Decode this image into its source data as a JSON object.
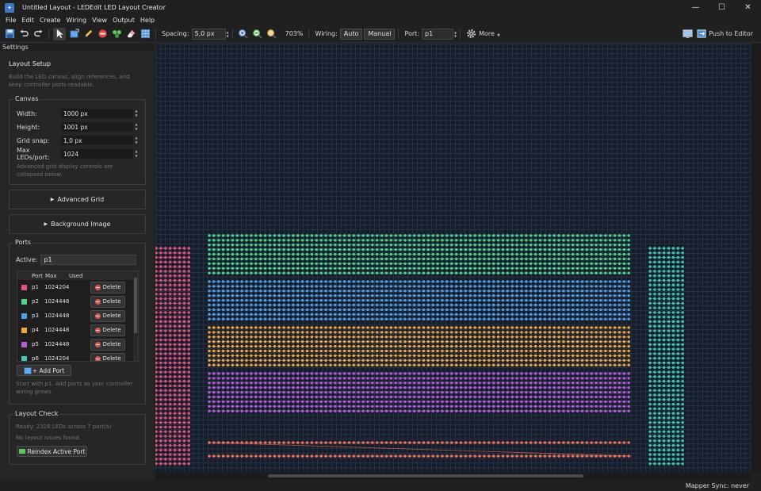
{
  "window": {
    "title": "Untitled Layout - LEDEdit LED Layout Creator"
  },
  "menu": [
    "File",
    "Edit",
    "Create",
    "Wiring",
    "View",
    "Output",
    "Help"
  ],
  "toolbar": {
    "spacing_label": "Spacing:",
    "spacing_value": "5,0 px",
    "zoom": "703%",
    "wiring_label": "Wiring:",
    "wiring_auto": "Auto",
    "wiring_manual": "Manual",
    "port_label": "Port:",
    "port_value": "p1",
    "more_label": "More",
    "push_label": "Push to Editor"
  },
  "settings_label": "Settings",
  "layout_setup": {
    "title": "Layout Setup",
    "description": "Build the LED canvas, align references, and keep controller ports readable."
  },
  "canvas_group": {
    "title": "Canvas",
    "fields": [
      {
        "label": "Width:",
        "value": "1000 px"
      },
      {
        "label": "Height:",
        "value": "1001 px"
      },
      {
        "label": "Grid snap:",
        "value": "1,0 px"
      },
      {
        "label": "Max LEDs/port:",
        "value": "1024"
      }
    ],
    "note": "Advanced grid display controls are collapsed below."
  },
  "advanced_grid": "Advanced Grid",
  "background_image": "Background Image",
  "ports": {
    "title": "Ports",
    "active_label": "Active:",
    "active_value": "p1",
    "headers": {
      "port": "Port",
      "max": "Max",
      "used": "Used"
    },
    "rows": [
      {
        "name": "p1",
        "max": "1024",
        "used": "204",
        "color": "#e8507a"
      },
      {
        "name": "p2",
        "max": "1024",
        "used": "448",
        "color": "#4cd48c"
      },
      {
        "name": "p3",
        "max": "1024",
        "used": "448",
        "color": "#4f9ee8"
      },
      {
        "name": "p4",
        "max": "1024",
        "used": "448",
        "color": "#f0a63a"
      },
      {
        "name": "p5",
        "max": "1024",
        "used": "448",
        "color": "#b35ad8"
      },
      {
        "name": "p6",
        "max": "1024",
        "used": "204",
        "color": "#3cc8b4"
      }
    ],
    "delete_label": "Delete",
    "add_label": "+ Add Port",
    "hint": "Start with p1. Add ports as your controller wiring grows."
  },
  "layout_check": {
    "title": "Layout Check",
    "ready": "Ready: 2328 LEDs across 7 port(s)",
    "issues": "No layout issues found.",
    "reindex_label": "Reindex Active Port"
  },
  "status": {
    "mapper_sync": "Mapper Sync: never"
  },
  "colors": {
    "p1": "#e8507a",
    "p2": "#4cd48c",
    "p3": "#4f9ee8",
    "p4": "#f0a63a",
    "p5": "#b35ad8",
    "p6": "#3cc8b4",
    "p7": "#f06e5a"
  }
}
